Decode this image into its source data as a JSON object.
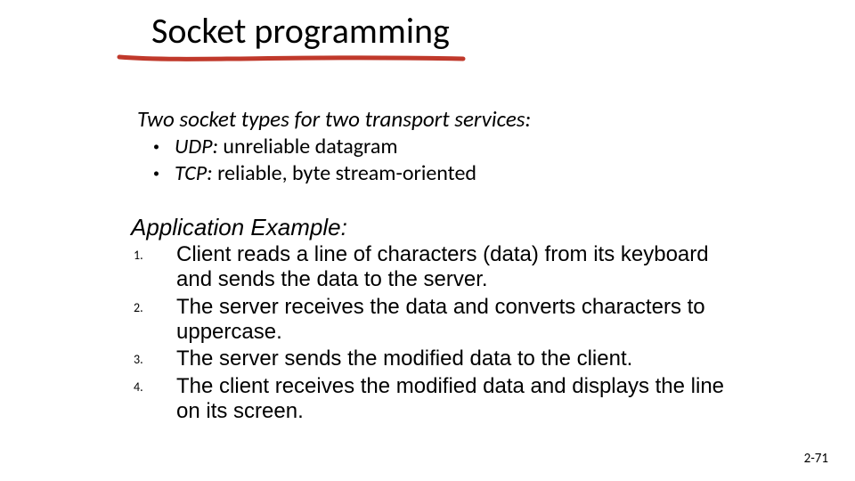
{
  "title": "Socket programming",
  "intro": "Two socket types for two transport services:",
  "bullets": [
    {
      "proto": "UDP:",
      "desc": "unreliable datagram"
    },
    {
      "proto": "TCP:",
      "desc": "reliable, byte stream-oriented"
    }
  ],
  "example_heading": "Application Example:",
  "steps": [
    "Client reads a line of characters (data) from its keyboard and sends the data to the server.",
    "The server receives the data and converts characters to uppercase.",
    "The server sends the modified data to the client.",
    "The client receives the modified data and displays the line on its screen."
  ],
  "page_number": "2-71"
}
